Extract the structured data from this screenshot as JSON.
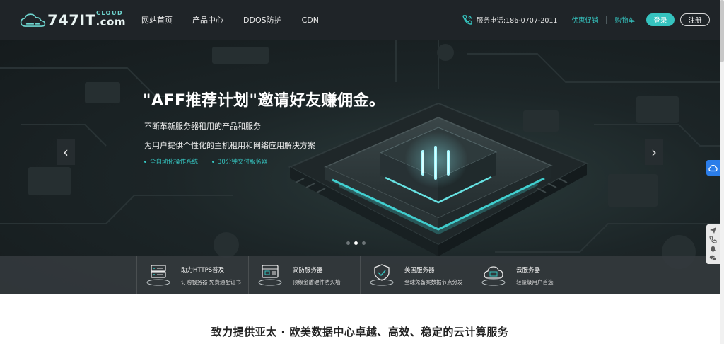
{
  "header": {
    "logo": {
      "main": "747IT",
      "suffix": ".com",
      "sub": "CLOUD"
    },
    "nav": [
      "网站首页",
      "产品中心",
      "DDOS防护",
      "CDN"
    ],
    "phone": "服务电话:186-0707-2011",
    "links": [
      "优惠促销",
      "购物车"
    ],
    "login_label": "登录",
    "register_label": "注册"
  },
  "hero": {
    "title": "\"AFF推荐计划\"邀请好友赚佣金。",
    "line1": "不断革新服务器租用的产品和服务",
    "line2": "为用户提供个性化的主机租用和网络应用解决方案",
    "features": [
      "全自动化操作系统",
      "30分钟交付服务器"
    ],
    "prev_arrow": "‹",
    "next_arrow": "›",
    "slides": {
      "count": 3,
      "active": 2
    }
  },
  "features": [
    {
      "icon": "ssl-certificate-icon",
      "title": "助力HTTPS普及",
      "desc": "订购服务器 免费通配证书"
    },
    {
      "icon": "firewall-server-icon",
      "title": "高防服务器",
      "desc": "顶级金盾硬件防火墙"
    },
    {
      "icon": "shield-icon",
      "title": "美国服务器",
      "desc": "全球免备案数据节点分发"
    },
    {
      "icon": "cloud-server-icon",
      "title": "云服务器",
      "desc": "轻量级用户首选"
    }
  ],
  "side": {
    "cloud_icon": "cloud-icon",
    "tools": [
      "send-icon",
      "phone-icon",
      "bell-icon",
      "wechat-icon"
    ]
  },
  "section": {
    "title": "致力提供亚太 · 欧美数据中心卓越、高效、稳定的云计算服务"
  },
  "colors": {
    "header_bg": "#1f2428",
    "accent": "#35c3bf",
    "hero_bg": "#1c2527",
    "feature_bar_bg": "#343a3d",
    "side_blue": "#2b7de9"
  }
}
